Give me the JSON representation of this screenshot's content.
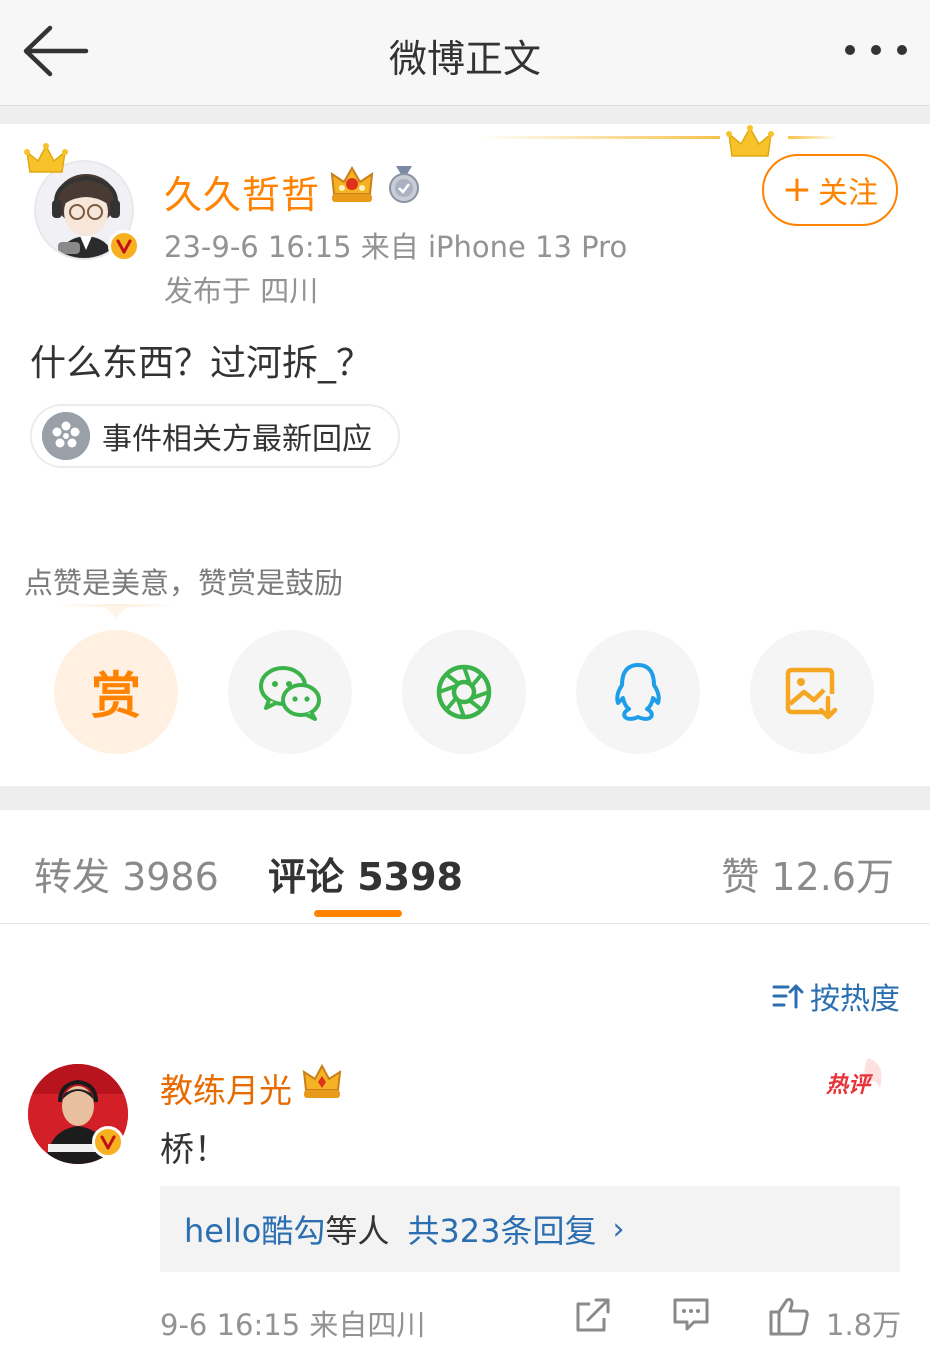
{
  "nav": {
    "title": "微博正文",
    "back_icon": "arrow-left-icon",
    "more_icon": "more-dots-icon"
  },
  "post": {
    "author": {
      "name": "久久哲哲",
      "verified": true,
      "icons": [
        "crown-icon",
        "vip-crown-icon",
        "medal-icon"
      ]
    },
    "meta": "23-9-6 16:15   来自 iPhone 13 Pro",
    "location": "发布于 四川",
    "follow_label": "关注",
    "follow_plus": "+",
    "text": "什么东西？过河拆_？",
    "topic_chip": "事件相关方最新回应",
    "reward_hint": "点赞是美意，赞赏是鼓励",
    "reward_label": "赏",
    "share_buttons": [
      "reward",
      "wechat-icon",
      "moments-icon",
      "qq-icon",
      "save-image-icon"
    ]
  },
  "tabs": [
    {
      "label": "转发 3986",
      "active": false
    },
    {
      "label": "评论 5398",
      "active": true
    },
    {
      "label": "赞 12.6万",
      "active": false
    }
  ],
  "comments": {
    "sort_label": "按热度",
    "items": [
      {
        "user": "教练月光",
        "verified": true,
        "badge": "热评",
        "text": "桥！",
        "reply_names": "hello酷勾",
        "reply_etc": "等人",
        "reply_count": "共323条回复",
        "reply_chevron": "›",
        "meta": "9-6 16:15  来自四川",
        "likes": "1.8万"
      }
    ]
  },
  "colors": {
    "accent": "#ff8200",
    "link": "#2c6fb0",
    "muted": "#939393",
    "bg_gap": "#eeeeee"
  }
}
